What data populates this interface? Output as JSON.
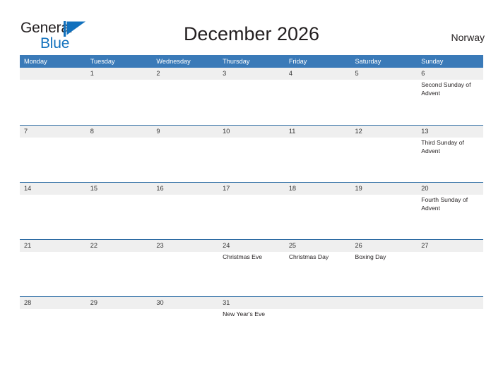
{
  "brand": {
    "name_part1": "General",
    "name_part2": "Blue",
    "flag_icon": "blue-triangle-flag-icon",
    "color_primary": "#1271bd",
    "color_text": "#231f20"
  },
  "header": {
    "title": "December 2026",
    "country": "Norway"
  },
  "theme": {
    "header_blue": "#3a7ab8",
    "row_divider_blue": "#2e6da4",
    "date_band_gray": "#efefef",
    "text_dark": "#231f20"
  },
  "calendar": {
    "weekdays": [
      "Monday",
      "Tuesday",
      "Wednesday",
      "Thursday",
      "Friday",
      "Saturday",
      "Sunday"
    ],
    "weeks": [
      [
        {
          "date": "",
          "events": []
        },
        {
          "date": "1",
          "events": []
        },
        {
          "date": "2",
          "events": []
        },
        {
          "date": "3",
          "events": []
        },
        {
          "date": "4",
          "events": []
        },
        {
          "date": "5",
          "events": []
        },
        {
          "date": "6",
          "events": [
            "Second Sunday of Advent"
          ]
        }
      ],
      [
        {
          "date": "7",
          "events": []
        },
        {
          "date": "8",
          "events": []
        },
        {
          "date": "9",
          "events": []
        },
        {
          "date": "10",
          "events": []
        },
        {
          "date": "11",
          "events": []
        },
        {
          "date": "12",
          "events": []
        },
        {
          "date": "13",
          "events": [
            "Third Sunday of Advent"
          ]
        }
      ],
      [
        {
          "date": "14",
          "events": []
        },
        {
          "date": "15",
          "events": []
        },
        {
          "date": "16",
          "events": []
        },
        {
          "date": "17",
          "events": []
        },
        {
          "date": "18",
          "events": []
        },
        {
          "date": "19",
          "events": []
        },
        {
          "date": "20",
          "events": [
            "Fourth Sunday of Advent"
          ]
        }
      ],
      [
        {
          "date": "21",
          "events": []
        },
        {
          "date": "22",
          "events": []
        },
        {
          "date": "23",
          "events": []
        },
        {
          "date": "24",
          "events": [
            "Christmas Eve"
          ]
        },
        {
          "date": "25",
          "events": [
            "Christmas Day"
          ]
        },
        {
          "date": "26",
          "events": [
            "Boxing Day"
          ]
        },
        {
          "date": "27",
          "events": []
        }
      ],
      [
        {
          "date": "28",
          "events": []
        },
        {
          "date": "29",
          "events": []
        },
        {
          "date": "30",
          "events": []
        },
        {
          "date": "31",
          "events": [
            "New Year's Eve"
          ]
        },
        {
          "date": "",
          "events": []
        },
        {
          "date": "",
          "events": []
        },
        {
          "date": "",
          "events": []
        }
      ]
    ]
  }
}
